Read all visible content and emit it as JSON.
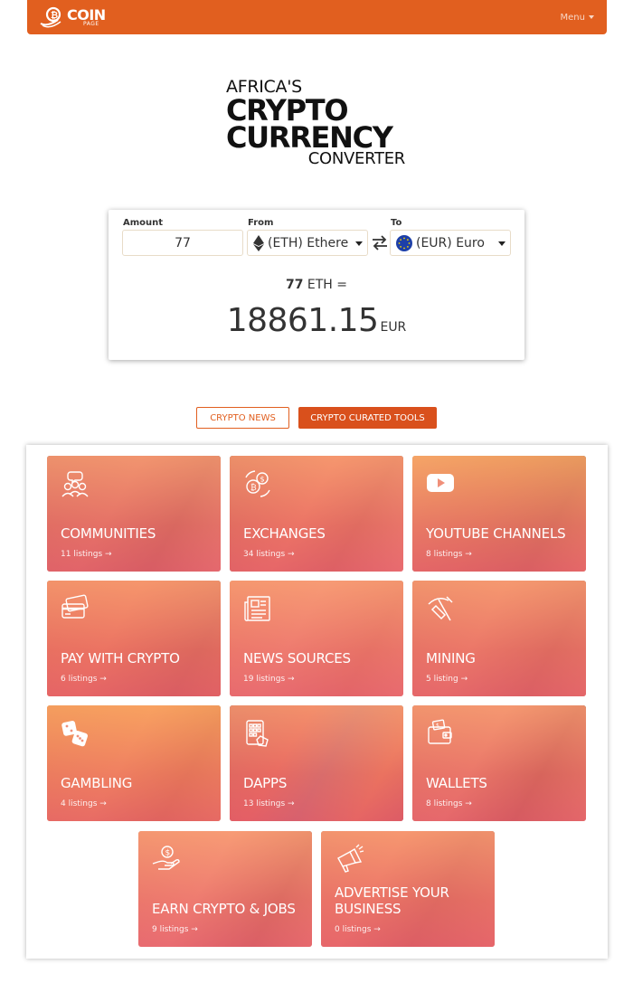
{
  "navbar": {
    "logo_text": "COIN",
    "logo_sub": "PAGE",
    "menu_label": "Menu"
  },
  "hero": {
    "line1": "AFRICA'S",
    "line2": "CRYPTO",
    "line3": "CURRENCY",
    "line4": "CONVERTER"
  },
  "converter": {
    "amount_label": "Amount",
    "from_label": "From",
    "to_label": "To",
    "amount_value": "77",
    "from_value": "(ETH) Ethere",
    "to_value": "(EUR) Euro",
    "result_amount": "77",
    "result_from_unit": "ETH =",
    "result_value": "18861.15",
    "result_unit": "EUR"
  },
  "tabs": {
    "news": "CRYPTO NEWS",
    "tools": "CRYPTO CURATED TOOLS"
  },
  "categories": [
    {
      "title": "COMMUNITIES",
      "count": "11 listings →",
      "icon": "people-chat-icon"
    },
    {
      "title": "EXCHANGES",
      "count": "34 listings →",
      "icon": "coin-exchange-icon"
    },
    {
      "title": "YOUTUBE CHANNELS",
      "count": "8 listings →",
      "icon": "youtube-play-icon"
    },
    {
      "title": "PAY WITH CRYPTO",
      "count": "6 listings →",
      "icon": "credit-card-icon"
    },
    {
      "title": "NEWS SOURCES",
      "count": "19 listings →",
      "icon": "newspaper-icon"
    },
    {
      "title": "MINING",
      "count": "5 listing →",
      "icon": "pickaxe-icon"
    },
    {
      "title": "GAMBLING",
      "count": "4 listings →",
      "icon": "dice-icon"
    },
    {
      "title": "DAPPS",
      "count": "13 listings →",
      "icon": "app-grid-icon"
    },
    {
      "title": "WALLETS",
      "count": "8 listings →",
      "icon": "wallet-icon"
    },
    {
      "title": "EARN CRYPTO & JOBS",
      "count": "9 listings →",
      "icon": "hand-coin-icon"
    },
    {
      "title": "ADVERTISE YOUR BUSINESS",
      "count": "0 listings →",
      "icon": "megaphone-icon"
    }
  ],
  "colors": {
    "brand": "#e15f1f",
    "tab_active": "#d9501c"
  }
}
